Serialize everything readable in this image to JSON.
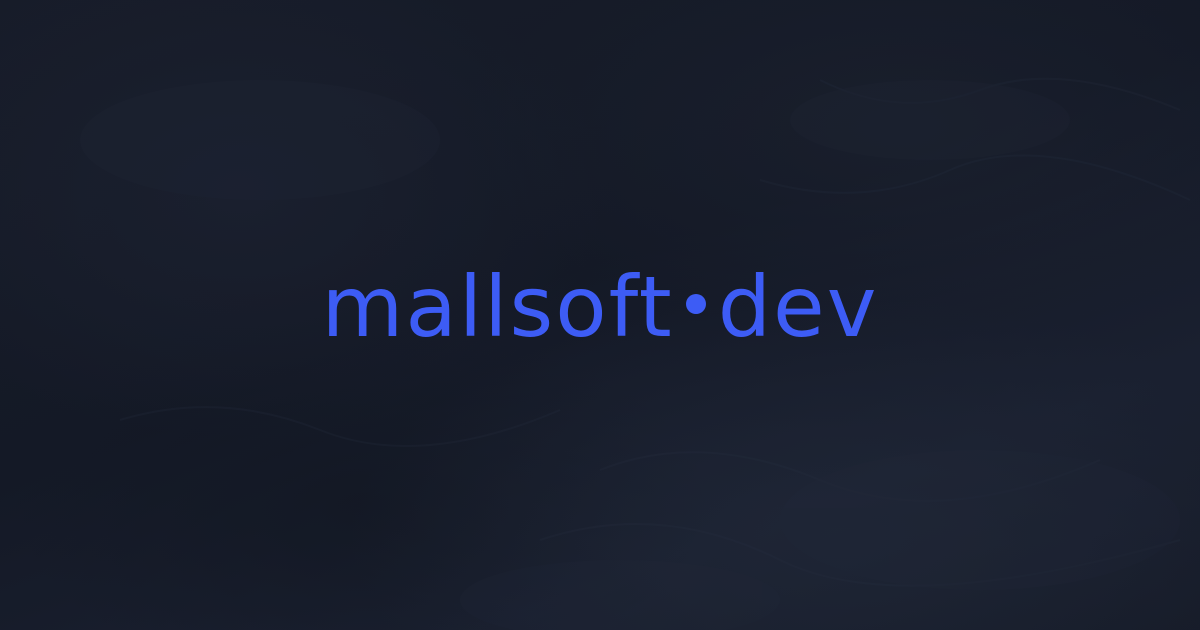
{
  "brand": {
    "name_left": "mallsoft",
    "name_right": "dev",
    "separator": "dot",
    "color": "#3d5cf5"
  },
  "background": {
    "color": "#151a26",
    "style": "dark textured"
  }
}
